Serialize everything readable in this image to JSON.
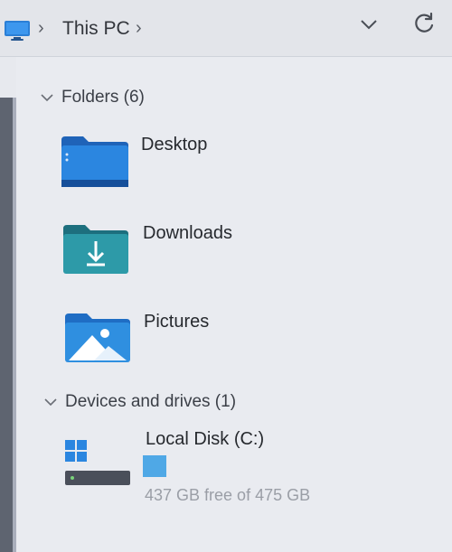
{
  "address_bar": {
    "location": "This PC",
    "icons": {
      "root": "this-pc-monitor-icon",
      "separator": "chevron-right-icon",
      "history": "chevron-down-icon",
      "refresh": "refresh-icon"
    }
  },
  "groups": [
    {
      "title": "Folders (6)",
      "expanded": true,
      "items": [
        {
          "label": "Desktop",
          "icon": "desktop-folder-icon",
          "color": "#2b86e0"
        },
        {
          "label": "Downloads",
          "icon": "downloads-folder-icon",
          "color": "#2d9aa8"
        },
        {
          "label": "Pictures",
          "icon": "pictures-folder-icon",
          "color": "#2f8fe0"
        }
      ]
    },
    {
      "title": "Devices and drives (1)",
      "expanded": true,
      "items": [
        {
          "label": "Local Disk (C:)",
          "icon": "local-disk-drive-icon",
          "space": "437 GB free of 475 GB",
          "used_fraction": 0.08,
          "bar_color": "#4fa8e6"
        }
      ]
    }
  ],
  "colors": {
    "background": "#e9ebf0",
    "accent": "#2b86e0",
    "muted_text": "#9a9ea6"
  }
}
